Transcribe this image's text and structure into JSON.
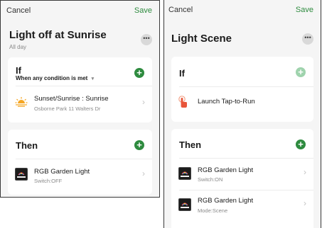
{
  "left": {
    "cancel": "Cancel",
    "save": "Save",
    "title": "Light off at Sunrise",
    "subtitle": "All day",
    "if": {
      "heading": "If",
      "condition": "When any condition is met",
      "condition_caret": "▾",
      "item": {
        "title": "Sunset/Sunrise : Sunrise",
        "sub": "Osborne Park 11 Walters Dr",
        "icon": "sunrise-icon"
      }
    },
    "then": {
      "heading": "Then",
      "item": {
        "title": "RGB Garden Light",
        "sub": "Switch:OFF",
        "icon": "rgb-light-device-icon"
      }
    }
  },
  "right": {
    "cancel": "Cancel",
    "save": "Save",
    "title": "Light Scene",
    "if": {
      "heading": "If",
      "item": {
        "title": "Launch Tap-to-Run",
        "icon": "tap-hand-icon"
      }
    },
    "then": {
      "heading": "Then",
      "items": [
        {
          "title": "RGB Garden Light",
          "sub": "Switch:ON",
          "icon": "rgb-light-device-icon"
        },
        {
          "title": "RGB Garden Light",
          "sub": "Mode:Scene",
          "icon": "rgb-light-device-icon"
        }
      ]
    }
  },
  "colors": {
    "accent_green": "#2e8b3f",
    "accent_green_faded": "#9fd3ad",
    "background": "#f5f5f5",
    "card": "#ffffff"
  }
}
